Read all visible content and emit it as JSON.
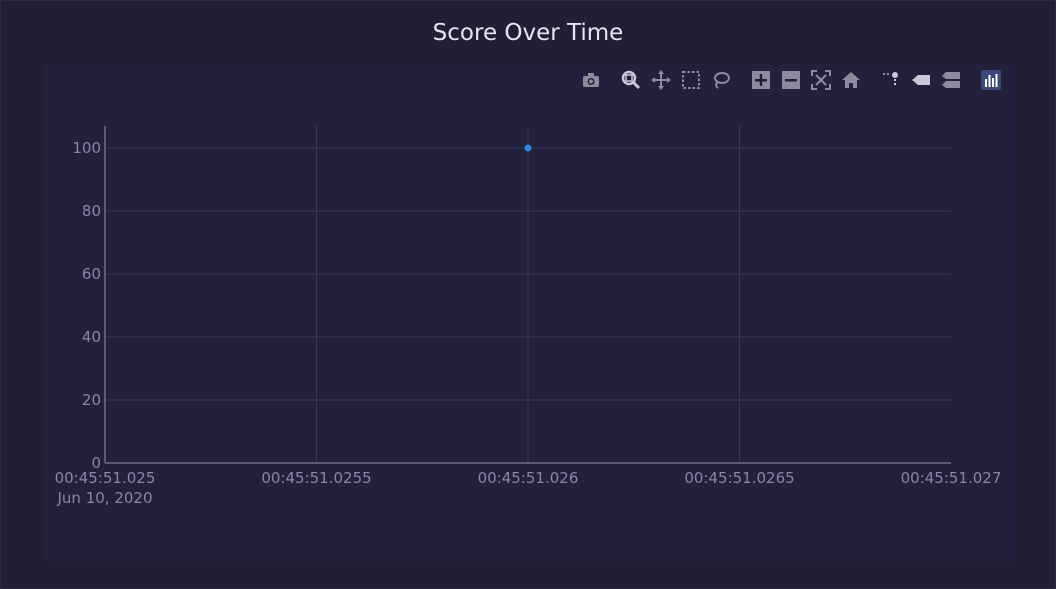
{
  "chart_data": {
    "type": "scatter",
    "title": "Score Over Time",
    "xlabel": "",
    "ylabel": "",
    "x_ticks": [
      "00:45:51.025",
      "00:45:51.0255",
      "00:45:51.026",
      "00:45:51.0265",
      "00:45:51.027"
    ],
    "x_tick_sub": "Jun 10, 2020",
    "x_tick_values_ms": [
      25.0,
      25.5,
      26.0,
      26.5,
      27.0
    ],
    "xlim_ms": [
      25.0,
      27.0
    ],
    "y_ticks": [
      0,
      20,
      40,
      60,
      80,
      100
    ],
    "ylim": [
      0,
      107
    ],
    "grid": true,
    "series": [
      {
        "points": [
          {
            "x_ms": 26.0,
            "y": 100
          }
        ]
      }
    ]
  },
  "colors": {
    "background": "#211f33",
    "grid": "#3a3853",
    "axis": "#6f6c8a",
    "marker": "#2a8ad4",
    "tick_text": "#8a86a8",
    "toolbar_icon": "#8d8a9e",
    "toolbar_active": "#c9c7d8"
  },
  "toolbar": {
    "buttons": [
      "camera-icon",
      "zoom-icon",
      "pan-icon",
      "box-select-icon",
      "lasso-select-icon",
      "zoom-in-icon",
      "zoom-out-icon",
      "autoscale-icon",
      "reset-axes-icon",
      "spike-lines-icon",
      "hover-closest-icon",
      "hover-compare-icon",
      "plotly-logo-icon"
    ]
  }
}
